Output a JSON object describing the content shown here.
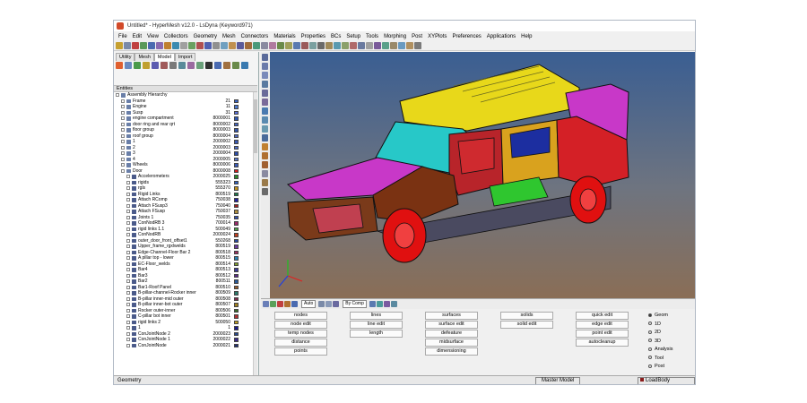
{
  "window": {
    "title": "Untitled* - HyperMesh v12.0 - LsDyna (Keyword971)"
  },
  "menu": [
    "File",
    "Edit",
    "View",
    "Collectors",
    "Geometry",
    "Mesh",
    "Connectors",
    "Materials",
    "Properties",
    "BCs",
    "Setup",
    "Tools",
    "Morphing",
    "Post",
    "XYPlots",
    "Preferences",
    "Applications",
    "Help"
  ],
  "browser": {
    "tabs": [
      "Utility",
      "Mesh",
      "Model",
      "Import"
    ],
    "active_tab": "Model",
    "entities_header": "Entities",
    "tree": [
      {
        "name": "Assembly Hierarchy",
        "id": "",
        "color": "",
        "level": 0,
        "icon": "assembly"
      },
      {
        "name": "Frame",
        "id": "21",
        "color": "#3a66c8",
        "level": 1,
        "icon": "assembly"
      },
      {
        "name": "Engine",
        "id": "11",
        "color": "#4a78d0",
        "level": 1,
        "icon": "assembly"
      },
      {
        "name": "Susp",
        "id": "31",
        "color": "#5a6fd8",
        "level": 1,
        "icon": "assembly"
      },
      {
        "name": "engine compartment",
        "id": "8000001",
        "color": "#2f56b0",
        "level": 1,
        "icon": "assembly"
      },
      {
        "name": "door ring and rear qrt",
        "id": "8000002",
        "color": "#4466c0",
        "level": 1,
        "icon": "assembly"
      },
      {
        "name": "floor group",
        "id": "8000003",
        "color": "#3355aa",
        "level": 1,
        "icon": "assembly"
      },
      {
        "name": "roof group",
        "id": "8000004",
        "color": "#506ac0",
        "level": 1,
        "icon": "assembly"
      },
      {
        "name": "1",
        "id": "2000002",
        "color": "#3a5ab4",
        "level": 1,
        "icon": "assembly"
      },
      {
        "name": "2",
        "id": "2000003",
        "color": "#4c6cc6",
        "level": 1,
        "icon": "assembly"
      },
      {
        "name": "3",
        "id": "2000004",
        "color": "#2e4ea8",
        "level": 1,
        "icon": "assembly"
      },
      {
        "name": "4",
        "id": "2000005",
        "color": "#5676cc",
        "level": 1,
        "icon": "assembly"
      },
      {
        "name": "Wheels",
        "id": "8000006",
        "color": "#3c5cb8",
        "level": 1,
        "icon": "assembly"
      },
      {
        "name": "Door",
        "id": "8000008",
        "color": "#d42020",
        "level": 1,
        "icon": "assembly"
      },
      {
        "name": "Accelerometers",
        "id": "2000025",
        "color": "#2a8a2a",
        "level": 2,
        "icon": "comp"
      },
      {
        "name": "rigids",
        "id": "555323",
        "color": "#3060c0",
        "level": 2,
        "icon": "comp"
      },
      {
        "name": "rgls",
        "id": "555370",
        "color": "#c09020",
        "level": 2,
        "icon": "comp"
      },
      {
        "name": "Rigid Links",
        "id": "800519",
        "color": "#1a7a4a",
        "level": 2,
        "icon": "comp"
      },
      {
        "name": "Attach RComp",
        "id": "750038",
        "color": "#2020a0",
        "level": 2,
        "icon": "comp"
      },
      {
        "name": "Attach FSusp3",
        "id": "750040",
        "color": "#a02020",
        "level": 2,
        "icon": "comp"
      },
      {
        "name": "Attach FSusp",
        "id": "750037",
        "color": "#b09040",
        "level": 2,
        "icon": "comp"
      },
      {
        "name": "Joints 1",
        "id": "750035",
        "color": "#3050b0",
        "level": 2,
        "icon": "comp"
      },
      {
        "name": "ConNodRB 3",
        "id": "700014",
        "color": "#9a2a6a",
        "level": 2,
        "icon": "comp"
      },
      {
        "name": "rigid links 1.1",
        "id": "500049",
        "color": "#4aa04a",
        "level": 2,
        "icon": "comp"
      },
      {
        "name": "ConNodRB",
        "id": "2000024",
        "color": "#c04020",
        "level": 2,
        "icon": "comp"
      },
      {
        "name": "outer_door_front_offset1",
        "id": "550268",
        "color": "#2a4aa0",
        "level": 2,
        "icon": "comp"
      },
      {
        "name": "Upper_frame_rgxlwelds",
        "id": "800519",
        "color": "#6a3aa0",
        "level": 2,
        "icon": "comp"
      },
      {
        "name": "Edge-Channel-Floor Bar 2",
        "id": "800518",
        "color": "#a03060",
        "level": 2,
        "icon": "comp"
      },
      {
        "name": "A pillar top - lower",
        "id": "800515",
        "color": "#2a80b0",
        "level": 2,
        "icon": "comp"
      },
      {
        "name": "EC-Floor_welds",
        "id": "800514",
        "color": "#80a030",
        "level": 2,
        "icon": "comp"
      },
      {
        "name": "Bar4",
        "id": "800513",
        "color": "#3a3a9a",
        "level": 2,
        "icon": "comp"
      },
      {
        "name": "Bar3",
        "id": "800512",
        "color": "#5a2a8a",
        "level": 2,
        "icon": "comp"
      },
      {
        "name": "Bar2",
        "id": "800511",
        "color": "#2a5a9a",
        "level": 2,
        "icon": "comp"
      },
      {
        "name": "Bar1-Roof Panel",
        "id": "800510",
        "color": "#9a5a2a",
        "level": 2,
        "icon": "comp"
      },
      {
        "name": "B-pillar-channel-Rocker inner",
        "id": "800509",
        "color": "#2a7a6a",
        "level": 2,
        "icon": "comp"
      },
      {
        "name": "B-pillar inner-mid outer",
        "id": "800508",
        "color": "#7a2a4a",
        "level": 2,
        "icon": "comp"
      },
      {
        "name": "B-pillar inner-bot outer",
        "id": "800507",
        "color": "#a08020",
        "level": 2,
        "icon": "comp"
      },
      {
        "name": "Rocker outer-inner",
        "id": "800506",
        "color": "#3a6a2a",
        "level": 2,
        "icon": "comp"
      },
      {
        "name": "C-pillar bot inner",
        "id": "800501",
        "color": "#b03030",
        "level": 2,
        "icon": "comp"
      },
      {
        "name": "rigid links 2",
        "id": "500050",
        "color": "#c0a020",
        "level": 2,
        "icon": "comp"
      },
      {
        "name": "1",
        "id": "1",
        "color": "#1a1a8a",
        "level": 2,
        "icon": "comp"
      },
      {
        "name": "ConJointNode 2",
        "id": "2000023",
        "color": "#2a4a8a",
        "level": 2,
        "icon": "comp"
      },
      {
        "name": "ConJointNode 1",
        "id": "2000022",
        "color": "#3a2a8a",
        "level": 2,
        "icon": "comp"
      },
      {
        "name": "ConJointNode",
        "id": "2000021",
        "color": "#203070",
        "level": 2,
        "icon": "comp"
      }
    ]
  },
  "panel_toolbar": {
    "auto_label": "Auto",
    "bycomp_label": "By Comp"
  },
  "geom_panel": {
    "columns": [
      [
        "nodes",
        "node edit",
        "temp nodes",
        "distance",
        "points"
      ],
      [
        "lines",
        "line edit",
        "length"
      ],
      [
        "surfaces",
        "surface edit",
        "defeature",
        "midsurface",
        "dimensioning"
      ],
      [
        "solids",
        "solid edit"
      ],
      [
        "quick edit",
        "edge edit",
        "point edit",
        "autocleanup"
      ]
    ],
    "radio": [
      "Geom",
      "1D",
      "2D",
      "3D",
      "Analysis",
      "Tool",
      "Post"
    ],
    "radio_selected": "Geom"
  },
  "status": {
    "left": "Geometry",
    "model": "Master Model",
    "component": "LoadBody"
  }
}
